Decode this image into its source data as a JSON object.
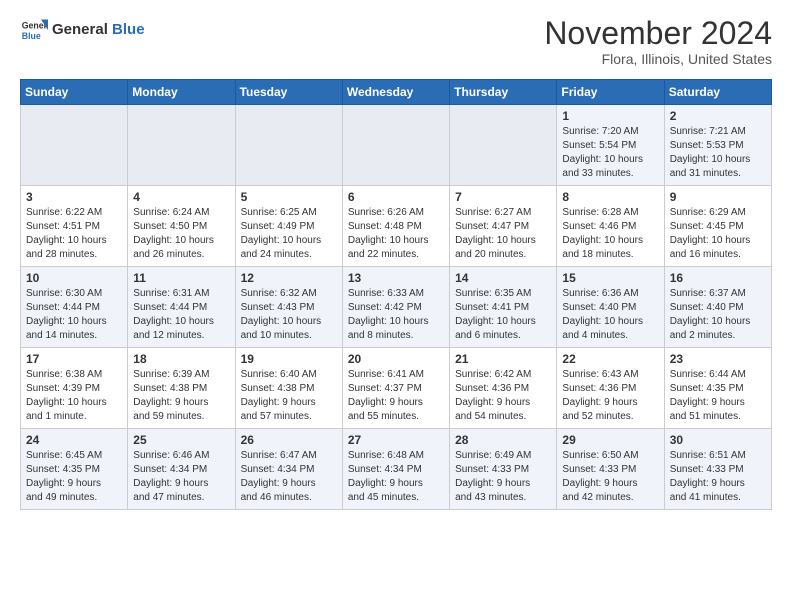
{
  "header": {
    "logo_general": "General",
    "logo_blue": "Blue",
    "month_title": "November 2024",
    "location": "Flora, Illinois, United States"
  },
  "weekdays": [
    "Sunday",
    "Monday",
    "Tuesday",
    "Wednesday",
    "Thursday",
    "Friday",
    "Saturday"
  ],
  "weeks": [
    [
      {
        "day": "",
        "info": ""
      },
      {
        "day": "",
        "info": ""
      },
      {
        "day": "",
        "info": ""
      },
      {
        "day": "",
        "info": ""
      },
      {
        "day": "",
        "info": ""
      },
      {
        "day": "1",
        "info": "Sunrise: 7:20 AM\nSunset: 5:54 PM\nDaylight: 10 hours\nand 33 minutes."
      },
      {
        "day": "2",
        "info": "Sunrise: 7:21 AM\nSunset: 5:53 PM\nDaylight: 10 hours\nand 31 minutes."
      }
    ],
    [
      {
        "day": "3",
        "info": "Sunrise: 6:22 AM\nSunset: 4:51 PM\nDaylight: 10 hours\nand 28 minutes."
      },
      {
        "day": "4",
        "info": "Sunrise: 6:24 AM\nSunset: 4:50 PM\nDaylight: 10 hours\nand 26 minutes."
      },
      {
        "day": "5",
        "info": "Sunrise: 6:25 AM\nSunset: 4:49 PM\nDaylight: 10 hours\nand 24 minutes."
      },
      {
        "day": "6",
        "info": "Sunrise: 6:26 AM\nSunset: 4:48 PM\nDaylight: 10 hours\nand 22 minutes."
      },
      {
        "day": "7",
        "info": "Sunrise: 6:27 AM\nSunset: 4:47 PM\nDaylight: 10 hours\nand 20 minutes."
      },
      {
        "day": "8",
        "info": "Sunrise: 6:28 AM\nSunset: 4:46 PM\nDaylight: 10 hours\nand 18 minutes."
      },
      {
        "day": "9",
        "info": "Sunrise: 6:29 AM\nSunset: 4:45 PM\nDaylight: 10 hours\nand 16 minutes."
      }
    ],
    [
      {
        "day": "10",
        "info": "Sunrise: 6:30 AM\nSunset: 4:44 PM\nDaylight: 10 hours\nand 14 minutes."
      },
      {
        "day": "11",
        "info": "Sunrise: 6:31 AM\nSunset: 4:44 PM\nDaylight: 10 hours\nand 12 minutes."
      },
      {
        "day": "12",
        "info": "Sunrise: 6:32 AM\nSunset: 4:43 PM\nDaylight: 10 hours\nand 10 minutes."
      },
      {
        "day": "13",
        "info": "Sunrise: 6:33 AM\nSunset: 4:42 PM\nDaylight: 10 hours\nand 8 minutes."
      },
      {
        "day": "14",
        "info": "Sunrise: 6:35 AM\nSunset: 4:41 PM\nDaylight: 10 hours\nand 6 minutes."
      },
      {
        "day": "15",
        "info": "Sunrise: 6:36 AM\nSunset: 4:40 PM\nDaylight: 10 hours\nand 4 minutes."
      },
      {
        "day": "16",
        "info": "Sunrise: 6:37 AM\nSunset: 4:40 PM\nDaylight: 10 hours\nand 2 minutes."
      }
    ],
    [
      {
        "day": "17",
        "info": "Sunrise: 6:38 AM\nSunset: 4:39 PM\nDaylight: 10 hours\nand 1 minute."
      },
      {
        "day": "18",
        "info": "Sunrise: 6:39 AM\nSunset: 4:38 PM\nDaylight: 9 hours\nand 59 minutes."
      },
      {
        "day": "19",
        "info": "Sunrise: 6:40 AM\nSunset: 4:38 PM\nDaylight: 9 hours\nand 57 minutes."
      },
      {
        "day": "20",
        "info": "Sunrise: 6:41 AM\nSunset: 4:37 PM\nDaylight: 9 hours\nand 55 minutes."
      },
      {
        "day": "21",
        "info": "Sunrise: 6:42 AM\nSunset: 4:36 PM\nDaylight: 9 hours\nand 54 minutes."
      },
      {
        "day": "22",
        "info": "Sunrise: 6:43 AM\nSunset: 4:36 PM\nDaylight: 9 hours\nand 52 minutes."
      },
      {
        "day": "23",
        "info": "Sunrise: 6:44 AM\nSunset: 4:35 PM\nDaylight: 9 hours\nand 51 minutes."
      }
    ],
    [
      {
        "day": "24",
        "info": "Sunrise: 6:45 AM\nSunset: 4:35 PM\nDaylight: 9 hours\nand 49 minutes."
      },
      {
        "day": "25",
        "info": "Sunrise: 6:46 AM\nSunset: 4:34 PM\nDaylight: 9 hours\nand 47 minutes."
      },
      {
        "day": "26",
        "info": "Sunrise: 6:47 AM\nSunset: 4:34 PM\nDaylight: 9 hours\nand 46 minutes."
      },
      {
        "day": "27",
        "info": "Sunrise: 6:48 AM\nSunset: 4:34 PM\nDaylight: 9 hours\nand 45 minutes."
      },
      {
        "day": "28",
        "info": "Sunrise: 6:49 AM\nSunset: 4:33 PM\nDaylight: 9 hours\nand 43 minutes."
      },
      {
        "day": "29",
        "info": "Sunrise: 6:50 AM\nSunset: 4:33 PM\nDaylight: 9 hours\nand 42 minutes."
      },
      {
        "day": "30",
        "info": "Sunrise: 6:51 AM\nSunset: 4:33 PM\nDaylight: 9 hours\nand 41 minutes."
      }
    ]
  ]
}
